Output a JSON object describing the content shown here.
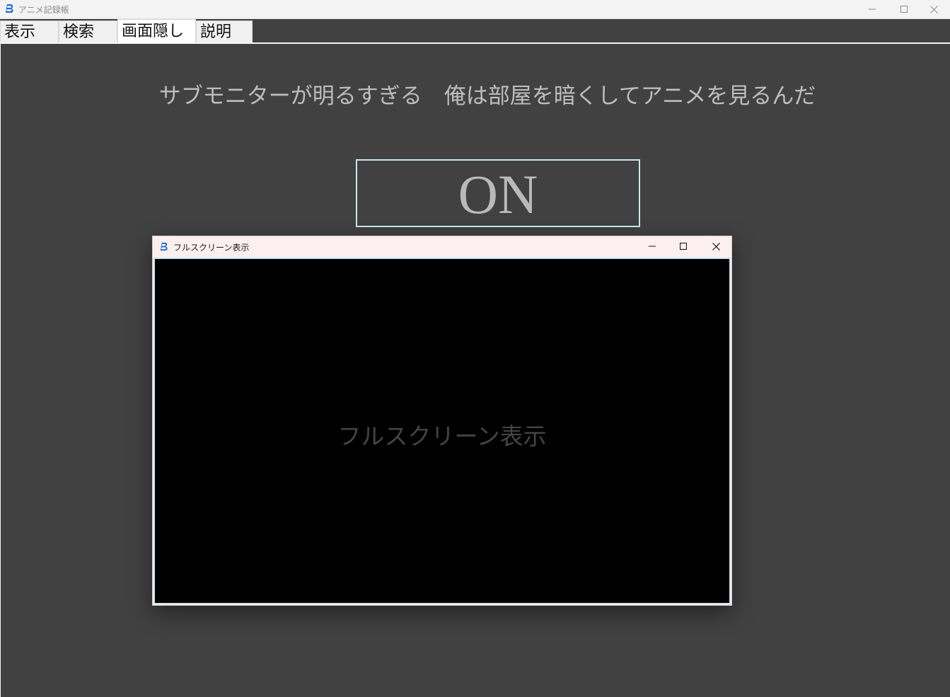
{
  "window": {
    "title": "アニメ記録帳",
    "logo_icon": "app-b-logo-icon",
    "controls": [
      "minimize-icon",
      "maximize-icon",
      "close-icon"
    ]
  },
  "tabs": [
    {
      "label": "表示",
      "selected": false
    },
    {
      "label": "検索",
      "selected": false
    },
    {
      "label": "画面隠し",
      "selected": true
    },
    {
      "label": "説明",
      "selected": false
    }
  ],
  "main": {
    "headline": "サブモニターが明るすぎる　俺は部屋を暗くしてアニメを見るんだ",
    "toggle_label": "ON"
  },
  "dialog": {
    "title": "フルスクリーン表示",
    "body_text": "フルスクリーン表示",
    "logo_icon": "app-b-logo-icon",
    "controls": [
      "minimize-icon",
      "maximize-icon",
      "close-icon"
    ]
  },
  "colors": {
    "background": "#414141",
    "text_light": "#bdbdbd",
    "accent_border": "#c8e6f5",
    "logo_blue": "#1565d8",
    "dialog_title_bg": "#fbf0ef"
  }
}
